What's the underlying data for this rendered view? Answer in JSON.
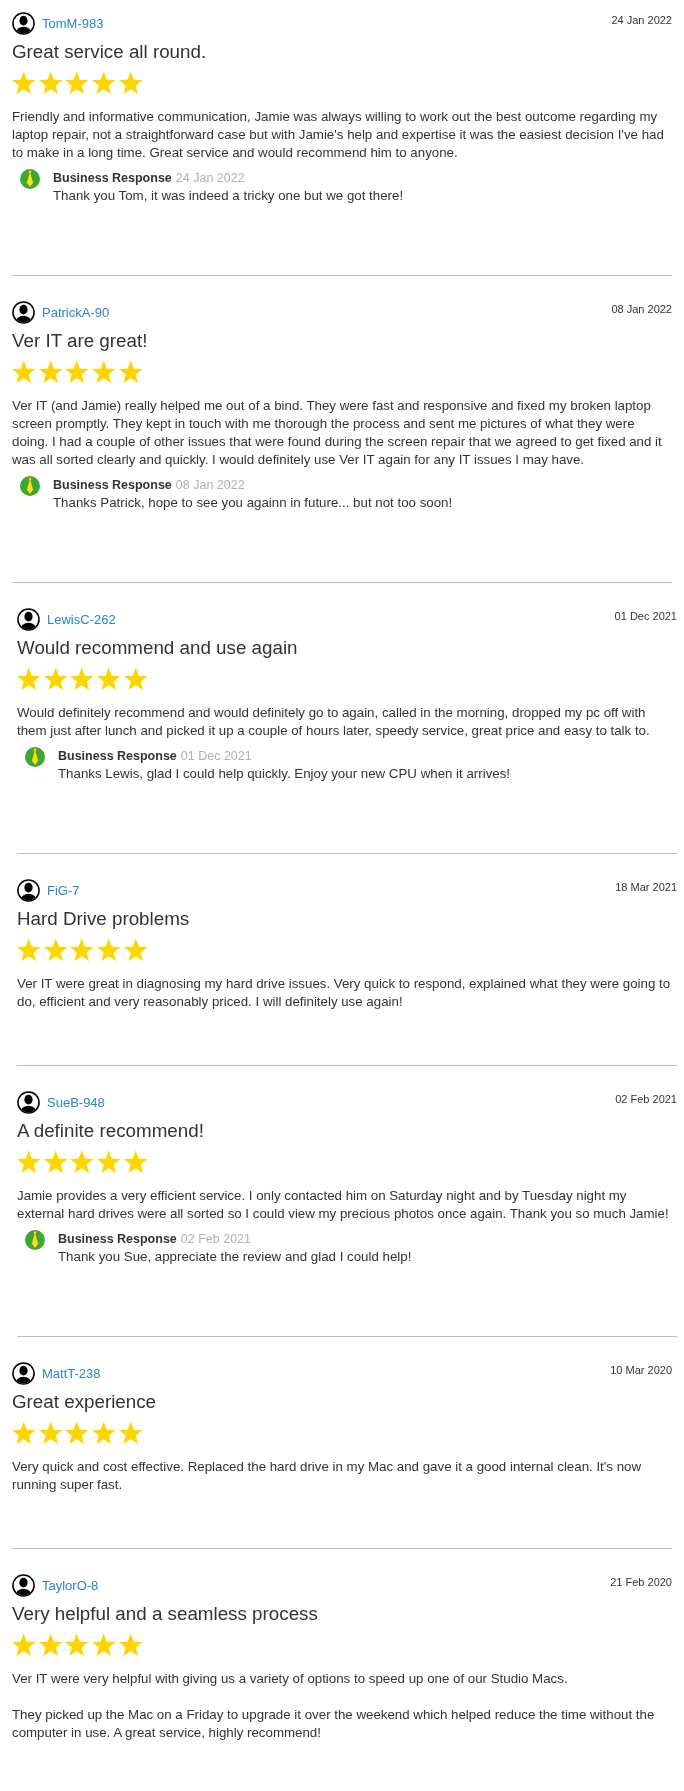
{
  "reviews": [
    {
      "author": "TomM-983",
      "date": "24 Jan 2022",
      "title": "Great service all round.",
      "stars": 5,
      "body": [
        "Friendly and informative communication, Jamie was always willing to work out the best outcome regarding my laptop repair, not a straightforward case but with Jamie's help and expertise it was the easiest decision I've had to make in a long time. Great service and would recommend him to anyone."
      ],
      "response": {
        "label": "Business Response",
        "date": "24 Jan 2022",
        "text": "Thank you Tom, it was indeed a tricky one but we got there!"
      }
    },
    {
      "author": "PatrickA-90",
      "date": "08 Jan 2022",
      "title": "Ver IT are great!",
      "stars": 5,
      "body": [
        "Ver IT (and Jamie) really helped me out of a bind. They were fast and responsive and fixed my broken laptop screen promptly. They kept in touch with me thorough the process and sent me pictures of what they were doing. I had a couple of other issues that were found during the screen repair that we agreed to get fixed and it was all sorted clearly and quickly. I would definitely use Ver IT again for any IT issues I may have."
      ],
      "response": {
        "label": "Business Response",
        "date": "08 Jan 2022",
        "text": "Thanks Patrick, hope to see you againn in future... but not too soon!"
      }
    },
    {
      "author": "LewisC-262",
      "date": "01 Dec 2021",
      "title": "Would recommend and use again",
      "stars": 5,
      "body": [
        "Would definitely recommend and would definitely go to again, called in the morning, dropped my pc off with them just after lunch and picked it up a couple of hours later, speedy service, great price and easy to talk to."
      ],
      "response": {
        "label": "Business Response",
        "date": "01 Dec 2021",
        "text": "Thanks Lewis, glad I could help quickly. Enjoy your new CPU when it arrives!"
      }
    },
    {
      "author": "FiG-7",
      "date": "18 Mar 2021",
      "title": "Hard Drive problems",
      "stars": 5,
      "body": [
        "Ver IT were great in diagnosing my hard drive issues. Very quick to respond, explained what they were going to do, efficient and very reasonably priced. I will definitely use again!"
      ]
    },
    {
      "author": "SueB-948",
      "date": "02 Feb 2021",
      "title": "A definite recommend!",
      "stars": 5,
      "body": [
        "Jamie provides a very efficient service. I only contacted him on Saturday night and by Tuesday night my external hard drives were all sorted so I could view my precious photos once again. Thank you so much Jamie!"
      ],
      "response": {
        "label": "Business Response",
        "date": "02 Feb 2021",
        "text": "Thank you Sue, appreciate the review and glad I could help!"
      }
    },
    {
      "author": "MattT-238",
      "date": "10 Mar 2020",
      "title": "Great experience",
      "stars": 5,
      "body": [
        "Very quick and cost effective. Replaced the hard drive in my Mac and gave it a good internal clean. It's now running super fast."
      ]
    },
    {
      "author": "TaylorO-8",
      "date": "21 Feb 2020",
      "title": "Very helpful and a seamless process",
      "stars": 5,
      "body": [
        "Ver IT were very helpful with giving us a variety of options to speed up one of our Studio Macs.",
        "They picked up the Mac on a Friday to upgrade it over the weekend which helped reduce the time without the computer in use. A great service, highly recommend!"
      ]
    }
  ]
}
